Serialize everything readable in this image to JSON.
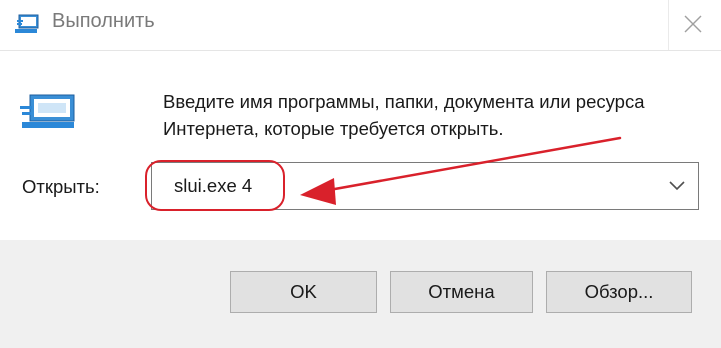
{
  "window": {
    "title": "Выполнить"
  },
  "content": {
    "description": "Введите имя программы, папки, документа или ресурса Интернета, которые требуется открыть.",
    "open_label": "Открыть:",
    "open_value": "slui.exe 4"
  },
  "buttons": {
    "ok": "OK",
    "cancel": "Отмена",
    "browse": "Обзор..."
  },
  "icons": {
    "title": "run-icon",
    "main": "run-icon",
    "close": "close-icon",
    "dropdown": "chevron-down-icon"
  },
  "colors": {
    "annotation": "#d9212b",
    "icon_blue": "#2b88d8"
  }
}
